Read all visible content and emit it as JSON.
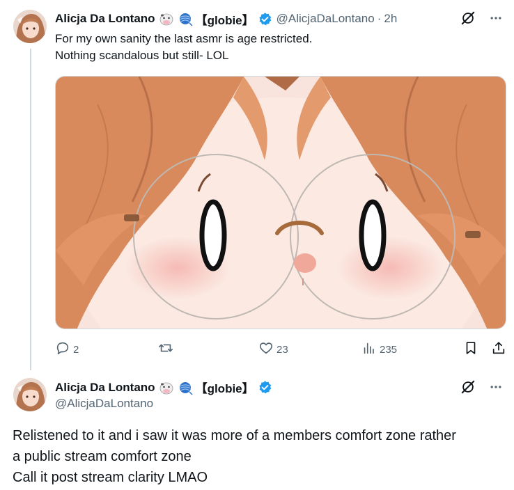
{
  "tweet1": {
    "author": {
      "name": "Alicja Da Lontano",
      "tag": "【globie】",
      "handle": "@AlicjaDaLontano",
      "time": "2h"
    },
    "text_lines": [
      "For my own sanity the last asmr is age restricted.",
      "Nothing scandalous but still- LOL"
    ],
    "stats": {
      "replies": "2",
      "retweets": "",
      "likes": "23",
      "views": "235"
    }
  },
  "tweet2": {
    "author": {
      "name": "Alicja Da Lontano",
      "tag": "【globie】",
      "handle": "@AlicjaDaLontano"
    },
    "text_lines": [
      "Relistened to it and i saw it was more of a members comfort zone rather",
      "a public stream comfort zone",
      "Call it post stream clarity LMAO"
    ]
  },
  "icons": {
    "emoji_1": "cow-face-icon",
    "emoji_2": "yarn-ball-icon",
    "verified": "verified-badge-icon",
    "grok": "grok-icon",
    "more": "more-icon",
    "reply": "reply-icon",
    "retweet": "retweet-icon",
    "like": "like-icon",
    "views": "views-icon",
    "bookmark": "bookmark-icon",
    "share": "share-icon"
  },
  "colors": {
    "text": "#0f1419",
    "secondary": "#536471",
    "verified": "#1d9bf0",
    "divider": "#cfd9de"
  }
}
